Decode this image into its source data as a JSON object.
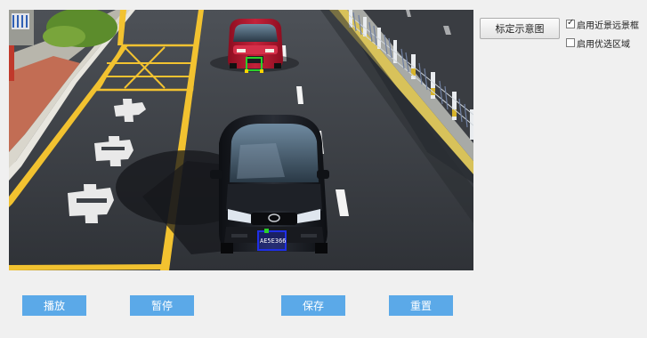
{
  "panel": {
    "calibration_button": "标定示意图",
    "options": [
      {
        "label": "启用近景远景框",
        "checked": true
      },
      {
        "label": "启用优选区域",
        "checked": false
      }
    ],
    "check_symbol": "✓"
  },
  "video": {
    "detections": [
      {
        "plate": "",
        "box_color": "#2bd12b"
      },
      {
        "plate": "AE5E366",
        "box_color": "#1f2fe6"
      }
    ]
  },
  "controls": {
    "play": "播放",
    "pause": "暂停",
    "save": "保存",
    "reset": "重置"
  },
  "colors": {
    "button_blue": "#5ba9e8",
    "lane_yellow": "#f2c230",
    "red_car": "#b5122b",
    "black_car": "#15171c"
  }
}
